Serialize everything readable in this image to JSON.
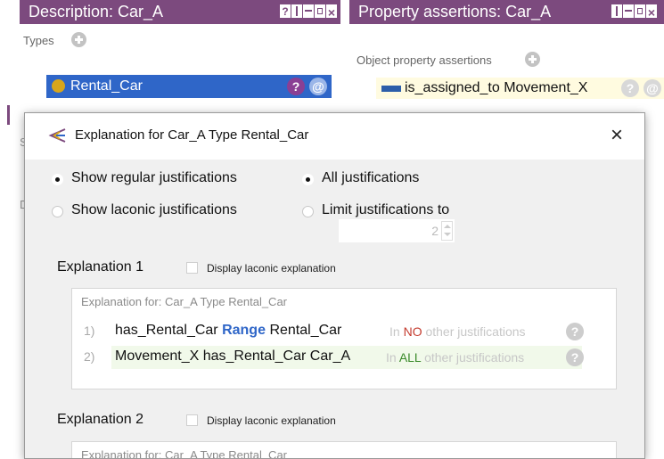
{
  "description_panel": {
    "title": "Description: Car_A",
    "types_label": "Types",
    "type_item": "Rental_Car",
    "item_help": "?",
    "item_at": "@",
    "hidden_labels": [
      "S",
      "D"
    ]
  },
  "property_panel": {
    "title": "Property assertions: Car_A",
    "object_label": "Object property assertions",
    "assertion": "is_assigned_to  Movement_X",
    "item_help": "?",
    "item_at": "@"
  },
  "dialog": {
    "title": "Explanation for Car_A Type Rental_Car",
    "close": "×",
    "options": {
      "show_regular": "Show regular justifications",
      "show_laconic": "Show laconic justifications",
      "all_justifications": "All justifications",
      "limit_justifications": "Limit justifications to",
      "limit_value": "2"
    },
    "explanations": [
      {
        "heading": "Explanation 1",
        "laconic_label": "Display laconic explanation",
        "for_text": "Explanation for: Car_A Type Rental_Car",
        "justifications": [
          {
            "num": "1)",
            "subject": "has_Rental_Car",
            "keyword": "Range",
            "object": "Rental_Car",
            "meta_prefix": "In",
            "meta_key": "NO",
            "meta_suffix": "other justifications",
            "help": "?"
          },
          {
            "num": "2)",
            "text": "Movement_X has_Rental_Car Car_A",
            "meta_prefix": "In",
            "meta_key": "ALL",
            "meta_suffix": "other justifications",
            "help": "?"
          }
        ]
      },
      {
        "heading": "Explanation 2",
        "laconic_label": "Display laconic explanation",
        "for_text": "Explanation for: Car_A Type Rental_Car"
      }
    ]
  },
  "colors": {
    "header_purple": "#7c4a7e",
    "selection_blue": "#2f66c8",
    "class_gold": "#d8a61c",
    "property_blue": "#2d5ea9",
    "no_red": "#c43b2e",
    "all_green": "#3a8a2a"
  }
}
